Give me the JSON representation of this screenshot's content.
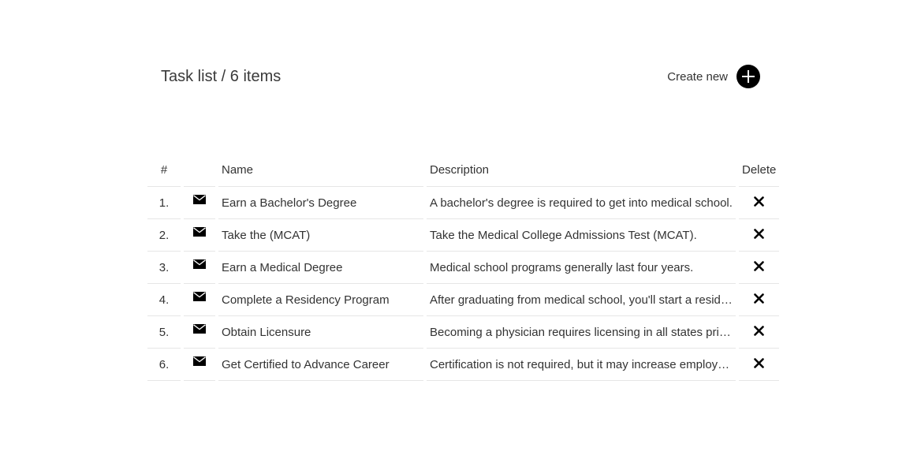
{
  "header": {
    "title": "Task list / 6 items",
    "create_label": "Create new"
  },
  "table": {
    "columns": [
      "#",
      "",
      "Name",
      "Description",
      "Delete"
    ],
    "rows": [
      {
        "num": "1.",
        "name": "Earn a Bachelor's Degree",
        "description": "A bachelor's degree is required to get into medical school."
      },
      {
        "num": "2.",
        "name": "Take the (MCAT)",
        "description": "Take the Medical College Admissions Test (MCAT)."
      },
      {
        "num": "3.",
        "name": "Earn a Medical Degree",
        "description": "Medical school programs generally last four years."
      },
      {
        "num": "4.",
        "name": "Complete a Residency Program",
        "description": "After graduating from medical school, you'll start a resid…"
      },
      {
        "num": "5.",
        "name": "Obtain Licensure",
        "description": "Becoming a physician requires licensing in all states pri…"
      },
      {
        "num": "6.",
        "name": "Get Certified to Advance Career",
        "description": "Certification is not required, but it may increase employ…"
      }
    ]
  },
  "icons": {
    "create": "plus-circle-icon",
    "row_icon": "envelope-icon",
    "delete": "close-icon"
  }
}
